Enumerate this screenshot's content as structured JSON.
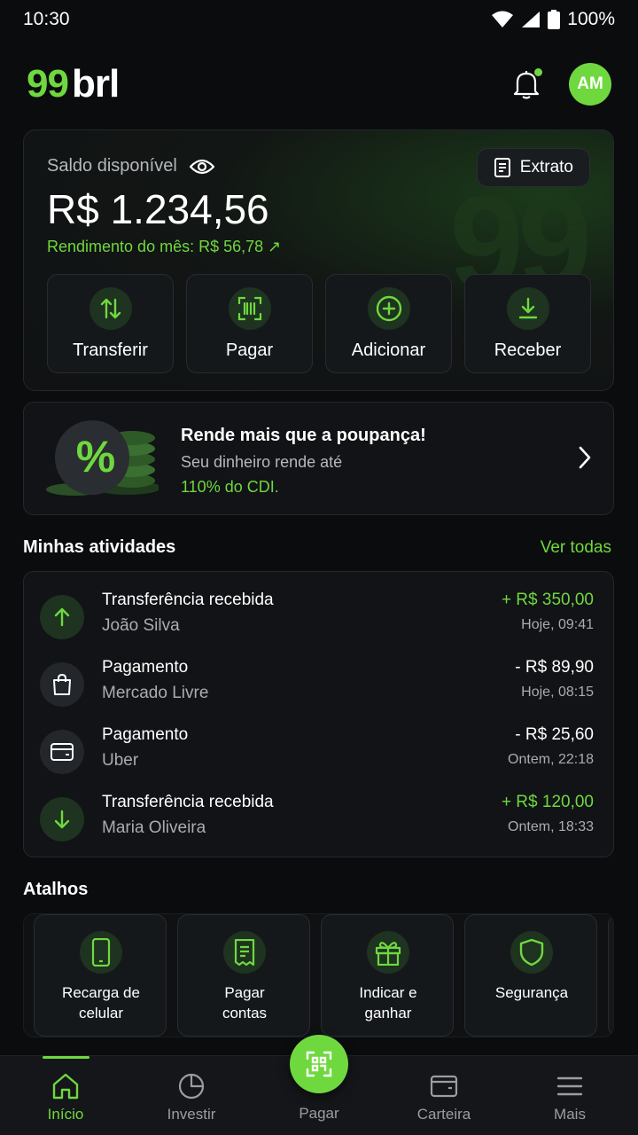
{
  "status_bar": {
    "time": "10:30",
    "battery": "100%"
  },
  "brand": {
    "logo_number": "99",
    "logo_text": "brl",
    "accent": "#6fd83f"
  },
  "header": {
    "avatar_initials": "AM"
  },
  "balance": {
    "label": "Saldo disponível",
    "statement_label": "Extrato",
    "value": "R$ 1.234,56",
    "month_yield": "Rendimento do mês: R$ 56,78 ↗",
    "watermark": "99",
    "actions": [
      {
        "label": "Transferir",
        "icon": "transfer-arrows-icon"
      },
      {
        "label": "Pagar",
        "icon": "barcode-scan-icon"
      },
      {
        "label": "Adicionar",
        "icon": "plus-circle-icon"
      },
      {
        "label": "Receber",
        "icon": "download-icon"
      }
    ]
  },
  "promo": {
    "title": "Rende mais que a poupança!",
    "subtitle": "Seu dinheiro rende até",
    "highlight": "110% do CDI.",
    "badge": "%"
  },
  "activities": {
    "title": "Minhas atividades",
    "see_all": "Ver todas",
    "items": [
      {
        "title": "Transferência recebida",
        "subtitle": "João Silva",
        "amount": "+ R$ 350,00",
        "time": "Hoje, 09:41",
        "icon": "arrow-up-icon",
        "positive": true
      },
      {
        "title": "Pagamento",
        "subtitle": "Mercado Livre",
        "amount": "- R$ 89,90",
        "time": "Hoje, 08:15",
        "icon": "shopping-bag-icon",
        "positive": false
      },
      {
        "title": "Pagamento",
        "subtitle": "Uber",
        "amount": "- R$ 25,60",
        "time": "Ontem, 22:18",
        "icon": "card-icon",
        "positive": false
      },
      {
        "title": "Transferência recebida",
        "subtitle": "Maria Oliveira",
        "amount": "+ R$ 120,00",
        "time": "Ontem, 18:33",
        "icon": "arrow-down-icon",
        "positive": true
      }
    ]
  },
  "shortcuts": {
    "title": "Atalhos",
    "items": [
      {
        "label": "Recarga de\ncelular",
        "icon": "phone-icon"
      },
      {
        "label": "Pagar\ncontas",
        "icon": "receipt-icon"
      },
      {
        "label": "Indicar e\nganhar",
        "icon": "gift-icon"
      },
      {
        "label": "Segurança",
        "icon": "shield-icon"
      }
    ]
  },
  "bottom_nav": {
    "items": [
      {
        "label": "Início",
        "icon": "home-icon",
        "active": true
      },
      {
        "label": "Investir",
        "icon": "pie-chart-icon",
        "active": false
      },
      {
        "label": "Pagar",
        "icon": "qr-code-icon",
        "active": false
      },
      {
        "label": "Carteira",
        "icon": "wallet-icon",
        "active": false
      },
      {
        "label": "Mais",
        "icon": "menu-icon",
        "active": false
      }
    ]
  }
}
